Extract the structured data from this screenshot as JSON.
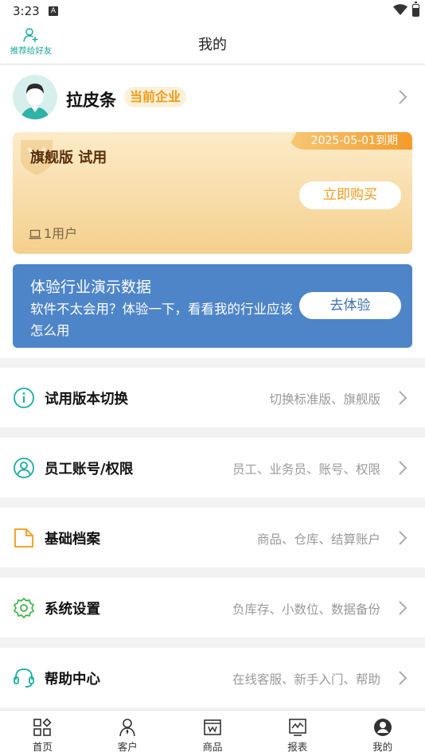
{
  "status_bar": {
    "time": "3:23",
    "indicator": "A"
  },
  "header": {
    "title": "我的",
    "recommend_label": "推荐给好友"
  },
  "profile": {
    "name": "拉皮条",
    "badge": "当前企业"
  },
  "plan": {
    "expiry": "2025-05-01到期",
    "name": "旗舰版 试用",
    "buy_label": "立即购买",
    "user_count": "1用户"
  },
  "demo": {
    "title": "体验行业演示数据",
    "description": "软件不太会用？体验一下，看看我的行业应该怎么用",
    "button_label": "去体验"
  },
  "menu": [
    {
      "label": "试用版本切换",
      "desc": "切换标准版、旗舰版",
      "icon": "info-icon"
    },
    {
      "label": "员工账号/权限",
      "desc": "员工、业务员、账号、权限",
      "icon": "user-circle-icon"
    },
    {
      "label": "基础档案",
      "desc": "商品、仓库、结算账户",
      "icon": "folder-icon"
    },
    {
      "label": "系统设置",
      "desc": "负库存、小数位、数据备份",
      "icon": "gear-icon"
    },
    {
      "label": "帮助中心",
      "desc": "在线客服、新手入门、帮助",
      "icon": "headset-icon"
    }
  ],
  "nav": [
    {
      "label": "首页",
      "icon": "home-grid-icon"
    },
    {
      "label": "客户",
      "icon": "customer-icon"
    },
    {
      "label": "商品",
      "icon": "product-icon"
    },
    {
      "label": "报表",
      "icon": "report-icon"
    },
    {
      "label": "我的",
      "icon": "profile-icon"
    }
  ],
  "colors": {
    "accent": "#1aaba0",
    "badge": "#f39a18",
    "demo_card": "#4e85c8",
    "plan_text": "#5a2f0e"
  }
}
